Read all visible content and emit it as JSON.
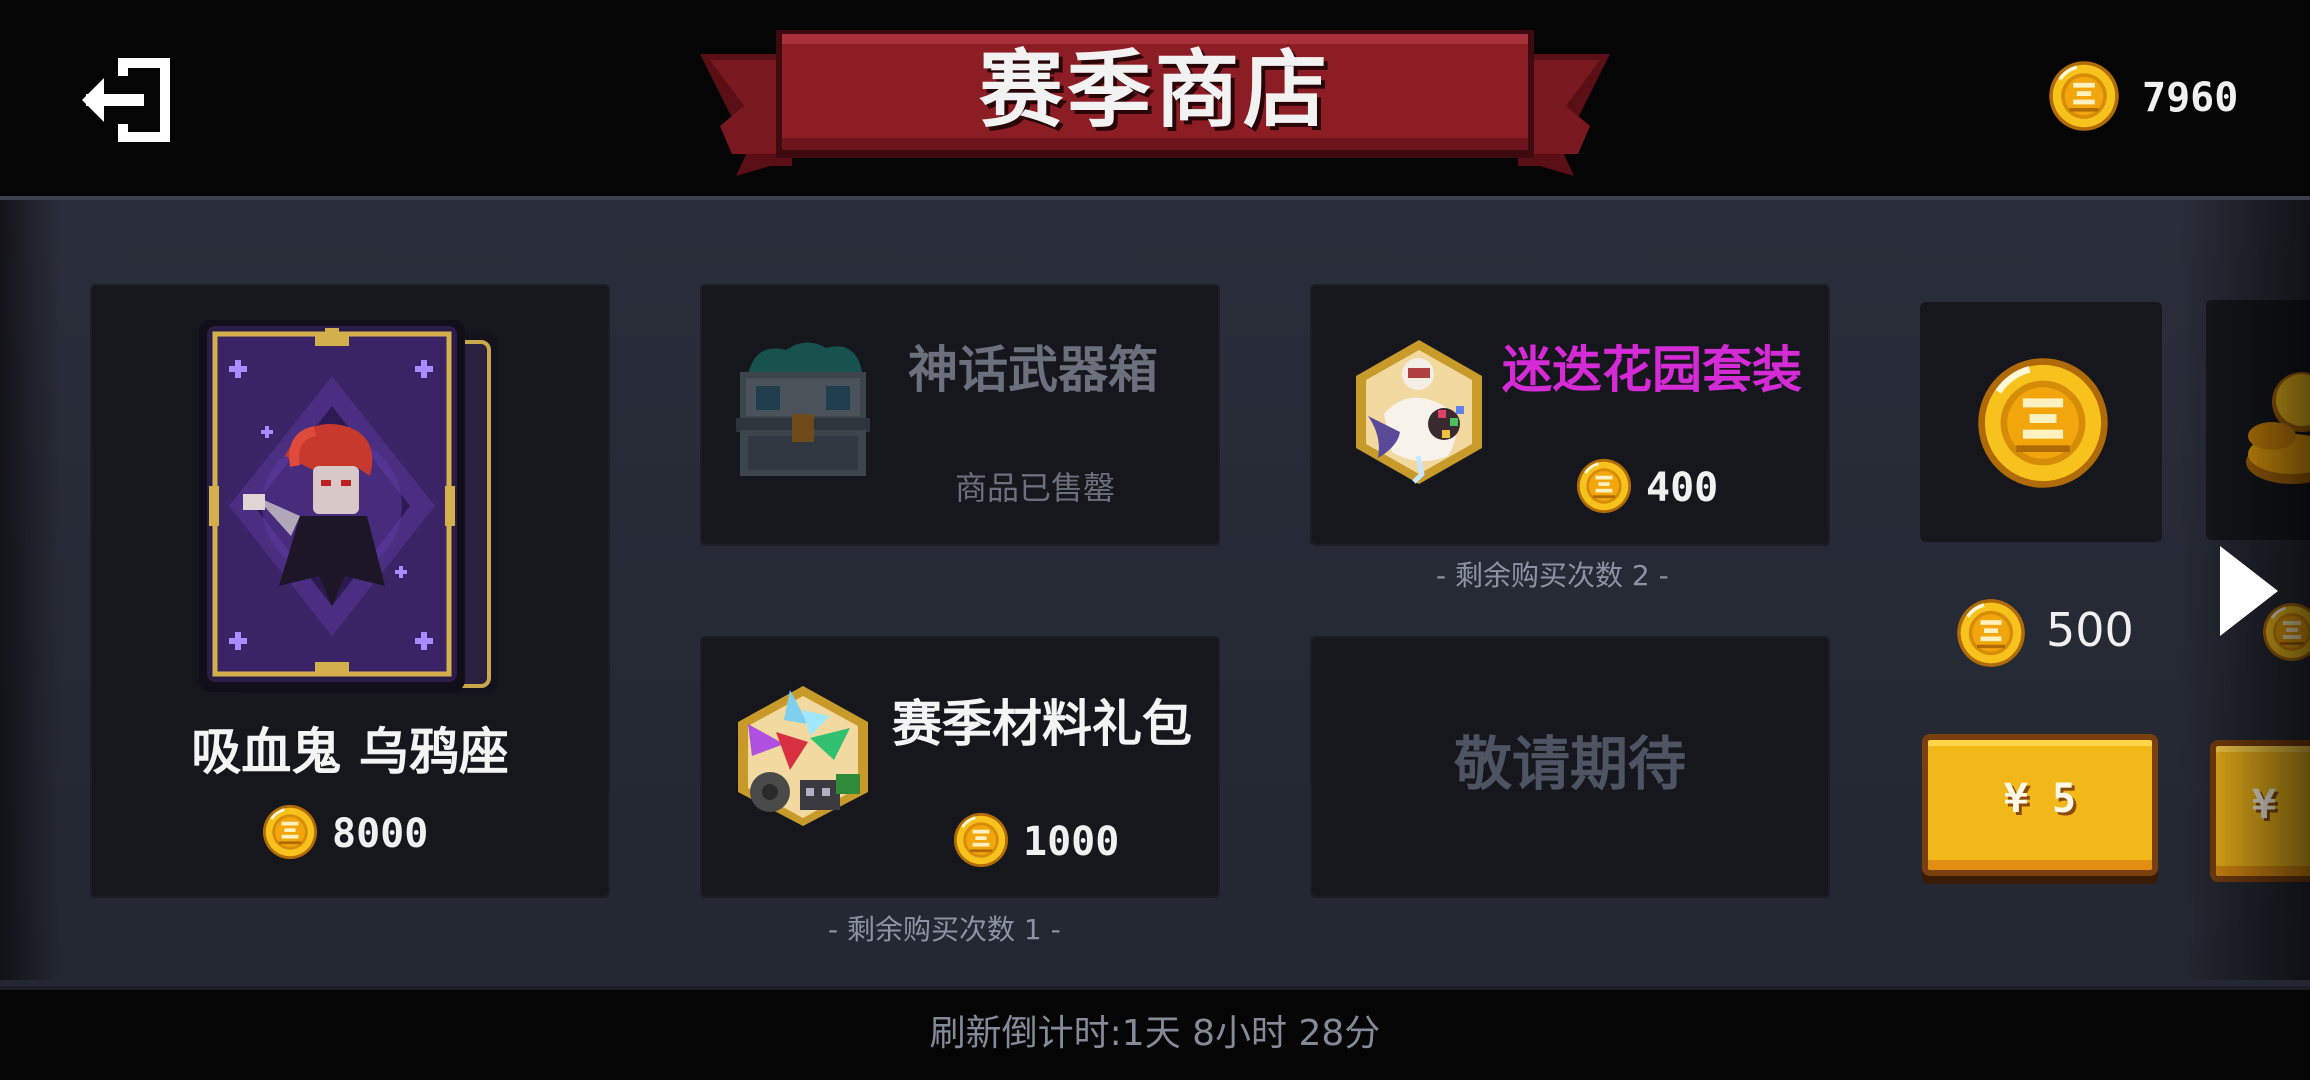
{
  "header": {
    "title": "赛季商店",
    "coin_balance": "7960",
    "colors": {
      "banner": "#8c1d25",
      "banner_dark": "#5a0f16"
    }
  },
  "items": {
    "feature": {
      "name": "吸血鬼 乌鸦座",
      "price": "8000"
    },
    "mythic_box": {
      "name": "神话武器箱",
      "status": "商品已售罄"
    },
    "garden_set": {
      "name": "迷迭花园套装",
      "price": "400",
      "remaining": "- 剩余购买次数 2 -",
      "color": "#d52bd6"
    },
    "material_pack": {
      "name": "赛季材料礼包",
      "price": "1000",
      "remaining": "- 剩余购买次数 1 -"
    },
    "coming_soon": {
      "label": "敬请期待"
    },
    "coin_pack": {
      "amount": "500",
      "buy_label": "¥ 5"
    },
    "next_pack": {
      "buy_label": "¥"
    }
  },
  "footer": {
    "refresh": "刷新倒计时:1天 8小时 28分"
  },
  "icons": [
    "exit-icon",
    "coin-icon",
    "chest-icon",
    "character-card-icon",
    "crystal-bundle-icon",
    "arrow-right-icon"
  ]
}
